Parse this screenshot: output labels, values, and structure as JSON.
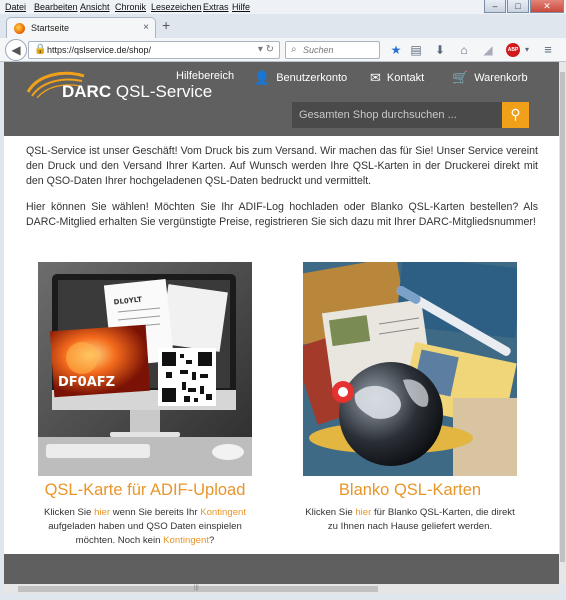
{
  "menubar": [
    "Datei",
    "Bearbeiten",
    "Ansicht",
    "Chronik",
    "Lesezeichen",
    "Extras",
    "Hilfe"
  ],
  "window_controls": {
    "minimize": "–",
    "maximize": "□",
    "close": "✕"
  },
  "tab": {
    "title": "Startseite",
    "close": "×",
    "new_tab": "+"
  },
  "address_bar": {
    "url": "https://qslservice.de/shop/"
  },
  "search_bar": {
    "placeholder": "Suchen"
  },
  "site": {
    "logo_bold": "DARC",
    "logo_light": "QSL-Service",
    "nav": [
      {
        "label": "Hilfebereich"
      },
      {
        "label": "Benutzerkonto"
      },
      {
        "label": "Kontakt"
      },
      {
        "label": "Warenkorb"
      }
    ],
    "search_placeholder": "Gesamten Shop durchsuchen ...",
    "accent_color": "#e8962a"
  },
  "intro": [
    "QSL-Service ist unser Geschäft! Vom Druck bis zum Versand. Wir machen das für Sie! Unser Service vereint den Druck und den Versand Ihrer Karten. Auf Wunsch werden Ihre QSL-Karten in der Druckerei direkt mit den QSO-Daten Ihrer hochgeladenen QSL-Daten bedruckt und vermittelt.",
    "Hier können Sie wählen! Möchten Sie Ihr ADIF-Log hochladen oder Blanko QSL-Karten bestellen? Als DARC-Mitglied erhalten Sie vergünstigte Preise, registrieren Sie sich dazu mit Ihrer DARC-Mitgliedsnummer!"
  ],
  "products": [
    {
      "title": "QSL-Karte für ADIF-Upload",
      "card_callsign": "DF0AFZ",
      "card_label": "DL0YLT",
      "desc_1": "Klicken Sie ",
      "link_1": "hier",
      "desc_2": " wenn Sie bereits Ihr ",
      "link_2": "Kontingent",
      "desc_3": " aufgeladen haben und QSO Daten einspielen möchten. Noch kein ",
      "link_3": "Kontingent",
      "desc_4": "?"
    },
    {
      "title": "Blanko QSL-Karten",
      "desc_1": "Klicken Sie ",
      "link_1": "hier",
      "desc_2": " für Blanko QSL-Karten, die direkt zu Ihnen nach Hause geliefert werden."
    }
  ]
}
